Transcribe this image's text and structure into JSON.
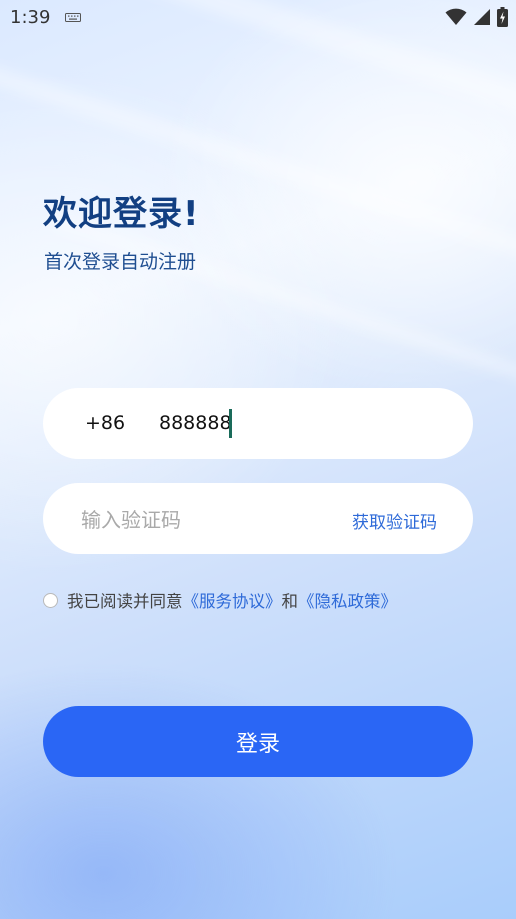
{
  "status_bar": {
    "time": "1:39",
    "icons": [
      "keyboard-icon",
      "wifi-icon",
      "signal-icon",
      "battery-charging-icon"
    ]
  },
  "header": {
    "title": "欢迎登录!",
    "subtitle": "首次登录自动注册"
  },
  "phone_field": {
    "country_code": "+86",
    "value": "888888"
  },
  "code_field": {
    "placeholder": "输入验证码",
    "value": "",
    "get_code_label": "获取验证码"
  },
  "agreement": {
    "checked": false,
    "prefix": "我已阅读并同意",
    "service_link": "《服务协议》",
    "conjunction": "和",
    "privacy_link": "《隐私政策》"
  },
  "login_button": {
    "label": "登录"
  },
  "colors": {
    "title": "#123f82",
    "link": "#2e6ad8",
    "button": "#2a66f5"
  }
}
